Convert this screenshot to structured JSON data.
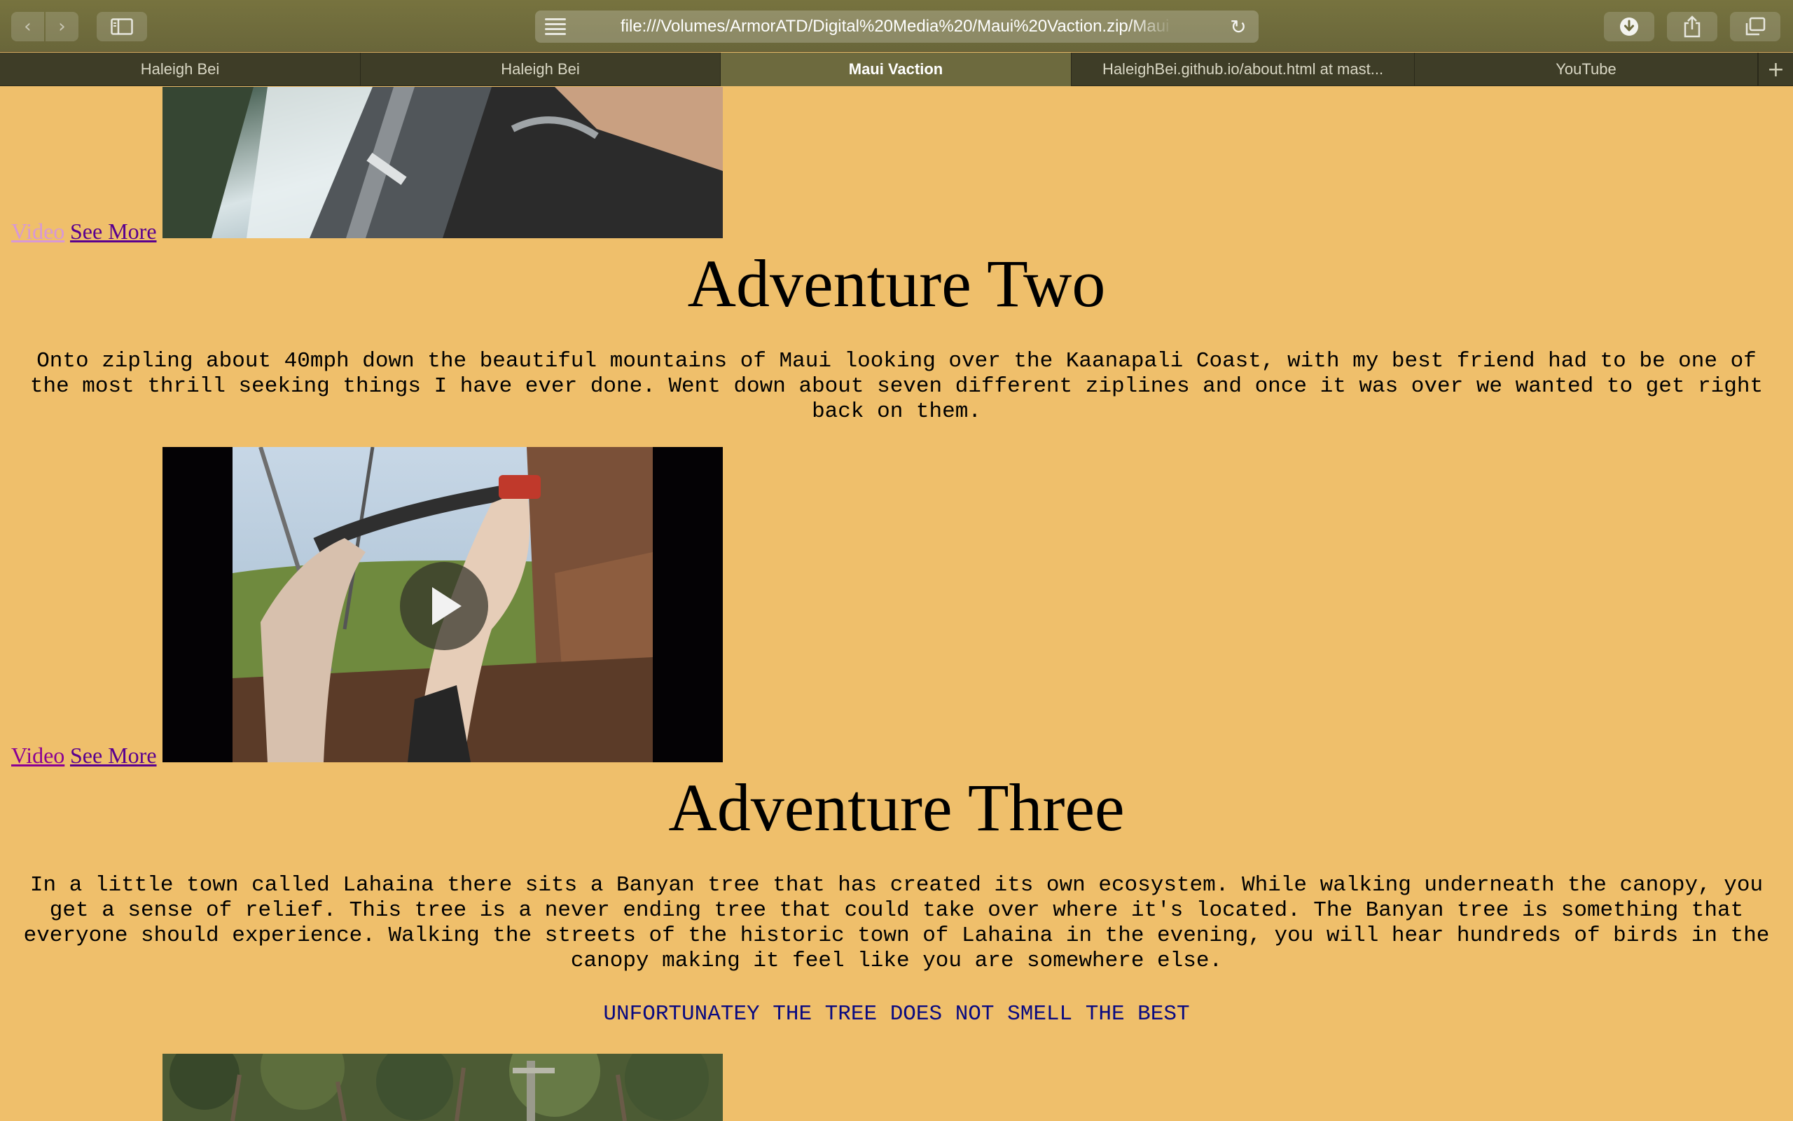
{
  "browser": {
    "url": "file:///Volumes/ArmorATD/Digital%20Media%20/Maui%20Vaction.zip/Maui",
    "tabs": [
      {
        "label": "Haleigh Bei",
        "active": false
      },
      {
        "label": "Haleigh Bei",
        "active": false
      },
      {
        "label": "Maui Vaction",
        "active": true
      },
      {
        "label": "HaleighBei.github.io/about.html at mast...",
        "active": false
      },
      {
        "label": "YouTube",
        "active": false
      }
    ],
    "icons": {
      "back": "chevron-left-icon",
      "forward": "chevron-right-icon",
      "sidebar": "sidebar-icon",
      "reader": "reader-icon",
      "reload": "reload-icon",
      "download": "download-icon",
      "share": "share-icon",
      "tabs": "tabs-overview-icon",
      "new_tab": "plus-icon"
    }
  },
  "page": {
    "background": "#efbf6b",
    "adventure_one": {
      "video_link": "Video",
      "see_more_link": "See More"
    },
    "adventure_two": {
      "title": "Adventure Two",
      "text": "Onto zipling about 40mph down the beautiful mountains of Maui looking over the Kaanapali Coast, with my best friend had to be one of the most thrill seeking things I have ever done. Went down about seven different ziplines and once it was over we wanted to get right back on them.",
      "video_link": "Video",
      "see_more_link": "See More"
    },
    "adventure_three": {
      "title": "Adventure Three",
      "text": "In a little town called Lahaina there sits a Banyan tree that has created its own ecosystem. While walking underneath the canopy, you get a sense of relief. This tree is a never ending tree that could take over where it's located. The Banyan tree is something that everyone should experience. Walking the streets of the historic town of Lahaina in the evening, you will hear hundreds of birds in the canopy making it feel like you are somewhere else.",
      "note": "UNFORTUNATEY THE TREE DOES NOT SMELL THE BEST"
    }
  }
}
